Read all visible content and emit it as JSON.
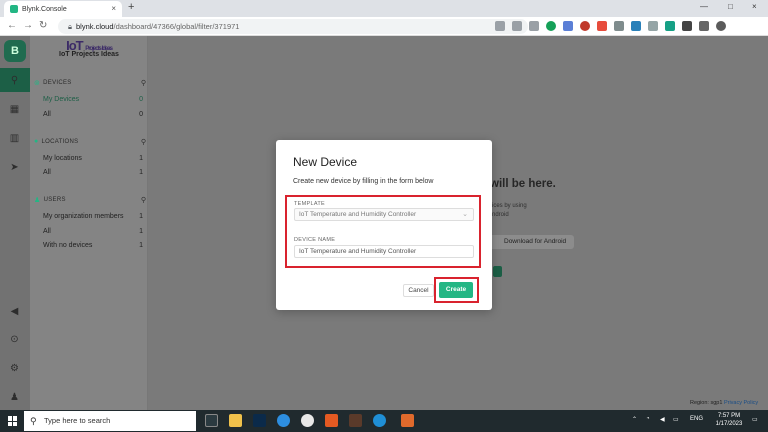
{
  "browser": {
    "tab_title": "Blynk.Console",
    "tab_close": "×",
    "new_tab": "+",
    "url_host": "blynk.cloud",
    "url_path": "/dashboard/47366/global/filter/371971",
    "back": "←",
    "forward": "→",
    "reload": "↻",
    "window_controls": [
      "—",
      "□",
      "×"
    ]
  },
  "rail": {
    "logo_letter": "B",
    "icons": [
      "search-icon",
      "grid-icon",
      "building-icon",
      "send-icon",
      "megaphone-icon",
      "help-icon",
      "settings-icon",
      "user-icon"
    ]
  },
  "brand": {
    "mark": "IoT",
    "mark_small": "Projects Ideas",
    "name": "IoT Projects Ideas"
  },
  "filters": {
    "devices": {
      "heading": "DEVICES",
      "items": [
        {
          "label": "My Devices",
          "count": "0"
        },
        {
          "label": "All",
          "count": "0"
        }
      ]
    },
    "locations": {
      "heading": "LOCATIONS",
      "items": [
        {
          "label": "My locations",
          "count": "1"
        },
        {
          "label": "All",
          "count": "1"
        }
      ]
    },
    "users": {
      "heading": "USERS",
      "items": [
        {
          "label": "My organization members",
          "count": "1"
        },
        {
          "label": "All",
          "count": "1"
        },
        {
          "label": "With no devices",
          "count": "1"
        }
      ]
    }
  },
  "background": {
    "headline": "will be here.",
    "line1": "ices by using",
    "line2": "ndroid",
    "download_btn": "Download for Android",
    "region_label": "Region: sgp1",
    "privacy": "Privacy Policy"
  },
  "modal": {
    "title": "New Device",
    "description": "Create new device by filling in the form below",
    "template_label": "TEMPLATE",
    "template_value": "IoT Temperature and Humidity Controller",
    "device_name_label": "DEVICE NAME",
    "device_name_value": "IoT Temperature and Humidity Controller",
    "cancel": "Cancel",
    "create": "Create"
  },
  "taskbar": {
    "search_placeholder": "Type here to search",
    "language": "ENG",
    "time": "7:57 PM",
    "date": "1/17/2023"
  },
  "colors": {
    "accent": "#23b684",
    "highlight": "#d9232e"
  }
}
